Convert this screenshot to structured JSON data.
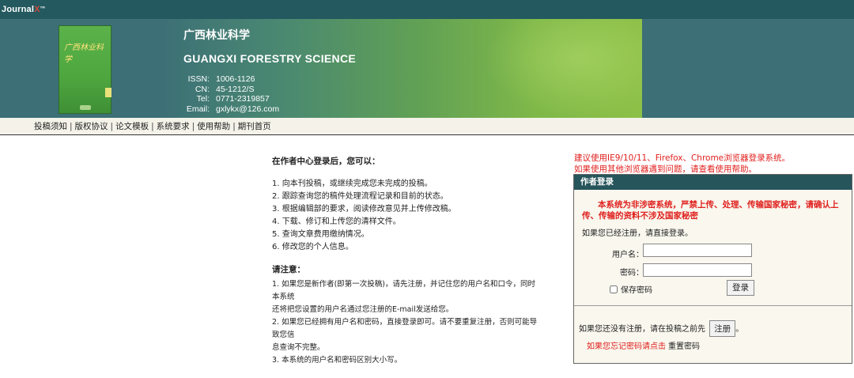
{
  "topbar": {
    "logo_text": "Journal",
    "logo_x": "X",
    "logo_tm": "TM"
  },
  "banner": {
    "cover_title": "广西林业科学",
    "title_cn": "广西林业科学",
    "title_en": "GUANGXI FORESTRY SCIENCE",
    "info": [
      {
        "label": "ISSN:",
        "value": "1006-1126"
      },
      {
        "label": "CN:",
        "value": "45-1212/S"
      },
      {
        "label": "Tel:",
        "value": "0771-2319857"
      },
      {
        "label": "Email:",
        "value": "gxlykx@126.com"
      }
    ],
    "colors": {
      "dark": "#3c6f76",
      "green": "#8dc047",
      "topbar": "#23595f"
    }
  },
  "nav": {
    "items": [
      "投稿须知",
      "版权协议",
      "论文模板",
      "系统要求",
      "使用帮助",
      "期刊首页"
    ]
  },
  "content": {
    "heading": "在作者中心登录后，您可以：",
    "list": [
      "1. 向本刊投稿，或继续完成您未完成的投稿。",
      "2. 跟踪查询您的稿件处理流程记录和目前的状态。",
      "3. 根据编辑部的要求，阅读修改意见并上传修改稿。",
      "4. 下载、修订和上传您的清样文件。",
      "5. 查询文章费用缴纳情况。",
      "6. 修改您的个人信息。"
    ],
    "notes_heading": "请注意：",
    "notes": [
      "1. 如果您是新作者(即第一次投稿)，请先注册，并记住您的用户名和口令，同时本系统",
      "还将把您设置的用户名通过您注册的E-mail发送给您。",
      "2. 如果您已经拥有用户名和密码，直接登录即可。请不要重复注册，否则可能导致您信",
      "息查询不完整。",
      "3. 本系统的用户名和密码区别大小写。"
    ]
  },
  "login": {
    "warn_line1": "建议使用IE9/10/11、Firefox、Chrome浏览器登录系统。",
    "warn_line2": "如果使用其他浏览器遇到问题，请查看使用帮助。",
    "header": "作者登录",
    "secret_notice": "本系统为非涉密系统，严禁上传、处理、传输国家秘密，请确认上传、传输的资料不涉及国家秘密",
    "registered_tip": "如果您已经注册，请直接登录。",
    "username_label": "用户名：",
    "password_label": "密码：",
    "username_value": "",
    "password_value": "",
    "remember_label": "保存密码",
    "login_button": "登录",
    "not_registered_tip": "如果您还没有注册，请在投稿之前先",
    "register_button": "注册",
    "period": "。",
    "forgot_tip": "如果您忘记密码请点击",
    "reset_link": "重置密码"
  }
}
